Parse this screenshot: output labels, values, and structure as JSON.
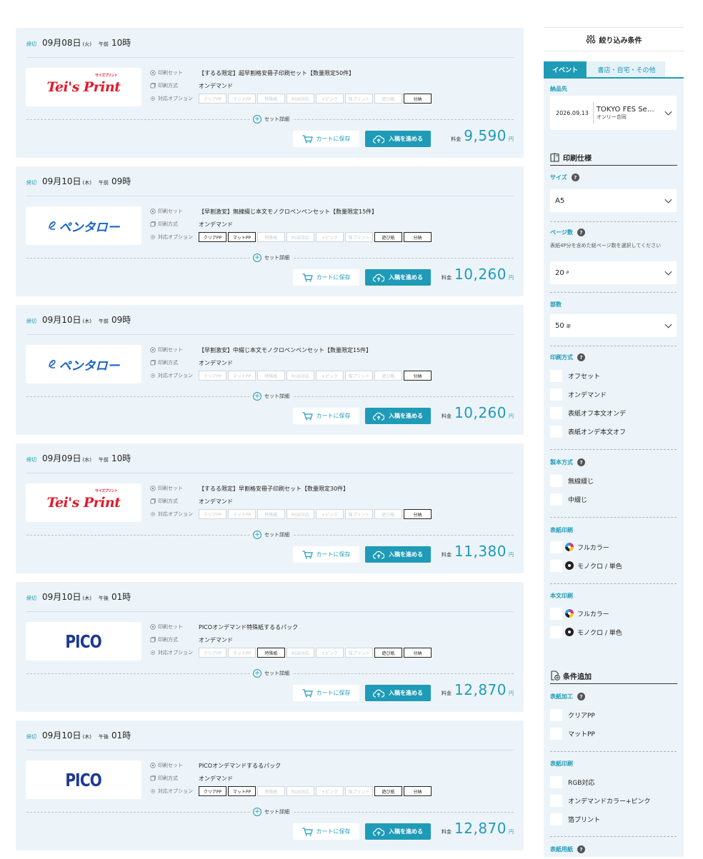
{
  "results": [
    {
      "deadline_label": "締切",
      "date": "09月08日",
      "dow": "(火)",
      "ampm": "午前",
      "time": "10時",
      "logo": "teis",
      "logo_text": "Tei's Print",
      "logo_sub": "サイズプリント",
      "print_set_label": "印刷セット",
      "print_set": "【するる限定】超早割格安冊子印刷セット【数量限定50件】",
      "method_label": "印刷方式",
      "method": "オンデマンド",
      "options_label": "対応オプション",
      "options": [
        {
          "label": "クリアPP",
          "on": false
        },
        {
          "label": "マットPP",
          "on": false
        },
        {
          "label": "特殊紙",
          "on": false
        },
        {
          "label": "RGB対応",
          "on": false
        },
        {
          "label": "+ピンク",
          "on": false
        },
        {
          "label": "箔プリント",
          "on": false
        },
        {
          "label": "遊び紙",
          "on": false
        },
        {
          "label": "分納",
          "on": true
        }
      ],
      "set_detail": "セット詳細",
      "cart_label": "カートに保存",
      "submit_label": "入稿を進める",
      "price_label": "料金",
      "price": "9,590",
      "unit": "円"
    },
    {
      "deadline_label": "締切",
      "date": "09月10日",
      "dow": "(木)",
      "ampm": "午前",
      "time": "09時",
      "logo": "pen",
      "logo_text": "ペンタロー",
      "logo_sub": "",
      "print_set_label": "印刷セット",
      "print_set": "【早割激安】無線綴じ本文モノクロペンペンセット【数量限定15件】",
      "method_label": "印刷方式",
      "method": "オンデマンド",
      "options_label": "対応オプション",
      "options": [
        {
          "label": "クリアPP",
          "on": true
        },
        {
          "label": "マットPP",
          "on": true
        },
        {
          "label": "特殊紙",
          "on": false
        },
        {
          "label": "RGB対応",
          "on": false
        },
        {
          "label": "+ピンク",
          "on": false
        },
        {
          "label": "箔プリント",
          "on": false
        },
        {
          "label": "遊び紙",
          "on": true
        },
        {
          "label": "分納",
          "on": true
        }
      ],
      "set_detail": "セット詳細",
      "cart_label": "カートに保存",
      "submit_label": "入稿を進める",
      "price_label": "料金",
      "price": "10,260",
      "unit": "円"
    },
    {
      "deadline_label": "締切",
      "date": "09月10日",
      "dow": "(木)",
      "ampm": "午前",
      "time": "09時",
      "logo": "pen",
      "logo_text": "ペンタロー",
      "logo_sub": "",
      "print_set_label": "印刷セット",
      "print_set": "【早割激安】中綴じ本文モノクロペンペンセット【数量限定15件】",
      "method_label": "印刷方式",
      "method": "オンデマンド",
      "options_label": "対応オプション",
      "options": [
        {
          "label": "クリアPP",
          "on": false
        },
        {
          "label": "マットPP",
          "on": false
        },
        {
          "label": "特殊紙",
          "on": false
        },
        {
          "label": "RGB対応",
          "on": false
        },
        {
          "label": "+ピンク",
          "on": false
        },
        {
          "label": "箔プリント",
          "on": false
        },
        {
          "label": "遊び紙",
          "on": false
        },
        {
          "label": "分納",
          "on": true
        }
      ],
      "set_detail": "セット詳細",
      "cart_label": "カートに保存",
      "submit_label": "入稿を進める",
      "price_label": "料金",
      "price": "10,260",
      "unit": "円"
    },
    {
      "deadline_label": "締切",
      "date": "09月09日",
      "dow": "(水)",
      "ampm": "午前",
      "time": "10時",
      "logo": "teis",
      "logo_text": "Tei's Print",
      "logo_sub": "サイズプリント",
      "print_set_label": "印刷セット",
      "print_set": "【するる限定】早割格安冊子印刷セット【数量限定30件】",
      "method_label": "印刷方式",
      "method": "オンデマンド",
      "options_label": "対応オプション",
      "options": [
        {
          "label": "クリアPP",
          "on": false
        },
        {
          "label": "マットPP",
          "on": false
        },
        {
          "label": "特殊紙",
          "on": false
        },
        {
          "label": "RGB対応",
          "on": false
        },
        {
          "label": "+ピンク",
          "on": false
        },
        {
          "label": "箔プリント",
          "on": false
        },
        {
          "label": "遊び紙",
          "on": false
        },
        {
          "label": "分納",
          "on": true
        }
      ],
      "set_detail": "セット詳細",
      "cart_label": "カートに保存",
      "submit_label": "入稿を進める",
      "price_label": "料金",
      "price": "11,380",
      "unit": "円"
    },
    {
      "deadline_label": "締切",
      "date": "09月10日",
      "dow": "(木)",
      "ampm": "午後",
      "time": "01時",
      "logo": "pico",
      "logo_text": "PICO",
      "logo_sub": "",
      "print_set_label": "印刷セット",
      "print_set": "PICOオンデマンド特殊紙するるパック",
      "method_label": "印刷方式",
      "method": "オンデマンド",
      "options_label": "対応オプション",
      "options": [
        {
          "label": "クリアPP",
          "on": false
        },
        {
          "label": "マットPP",
          "on": false
        },
        {
          "label": "特殊紙",
          "on": true
        },
        {
          "label": "RGB対応",
          "on": false
        },
        {
          "label": "+ピンク",
          "on": false
        },
        {
          "label": "箔プリント",
          "on": false
        },
        {
          "label": "遊び紙",
          "on": true
        },
        {
          "label": "分納",
          "on": true
        }
      ],
      "set_detail": "セット詳細",
      "cart_label": "カートに保存",
      "submit_label": "入稿を進める",
      "price_label": "料金",
      "price": "12,870",
      "unit": "円"
    },
    {
      "deadline_label": "締切",
      "date": "09月10日",
      "dow": "(木)",
      "ampm": "午後",
      "time": "01時",
      "logo": "pico",
      "logo_text": "PICO",
      "logo_sub": "",
      "print_set_label": "印刷セット",
      "print_set": "PICOオンデマンドするるパック",
      "method_label": "印刷方式",
      "method": "オンデマンド",
      "options_label": "対応オプション",
      "options": [
        {
          "label": "クリアPP",
          "on": true
        },
        {
          "label": "マットPP",
          "on": true
        },
        {
          "label": "特殊紙",
          "on": false
        },
        {
          "label": "RGB対応",
          "on": false
        },
        {
          "label": "+ピンク",
          "on": false
        },
        {
          "label": "箔プリント",
          "on": false
        },
        {
          "label": "遊び紙",
          "on": true
        },
        {
          "label": "分納",
          "on": true
        }
      ],
      "set_detail": "セット詳細",
      "cart_label": "カートに保存",
      "submit_label": "入稿を進める",
      "price_label": "料金",
      "price": "12,870",
      "unit": "円"
    }
  ],
  "sidebar": {
    "title": "絞り込み条件",
    "tab_event": "イベント",
    "tab_other": "書店・自宅・その他",
    "delivery_label": "納品先",
    "delivery_date": "2026.09.13",
    "delivery_event": "TOKYO FES Se…",
    "delivery_sub": "オンリー合同",
    "spec_title": "印刷仕様",
    "size_label": "サイズ",
    "size_value": "A5",
    "pages_label": "ページ数",
    "pages_hint": "表紙4P分を含めた総ページ数を選択してください",
    "pages_value": "20",
    "pages_unit": "P",
    "copies_label": "部数",
    "copies_value": "50",
    "copies_unit": "部",
    "method_label": "印刷方式",
    "method_options": [
      "オフセット",
      "オンデマンド",
      "表紙オフ本文オンデ",
      "表紙オンデ本文オフ"
    ],
    "binding_label": "製本方式",
    "binding_options": [
      "無線綴じ",
      "中綴じ"
    ],
    "cover_print_label": "表紙印刷",
    "cover_print_options": [
      "フルカラー",
      "モノクロ / 単色"
    ],
    "body_print_label": "本文印刷",
    "body_print_options": [
      "フルカラー",
      "モノクロ / 単色"
    ],
    "extra_title": "条件追加",
    "cover_process_label": "表紙加工",
    "cover_process_options": [
      "クリアPP",
      "マットPP"
    ],
    "cover_print2_label": "表紙印刷",
    "cover_print2_options": [
      "RGB対応",
      "オンデマンドカラー+ピンク",
      "箔プリント"
    ],
    "cover_paper_label": "表紙用紙"
  },
  "colors": {
    "accent": "#1f9bb8",
    "card_bg": "#edf4f9",
    "teis_red": "#e11a2b",
    "pen_blue": "#1763c5",
    "pico_navy": "#1d3a92"
  }
}
